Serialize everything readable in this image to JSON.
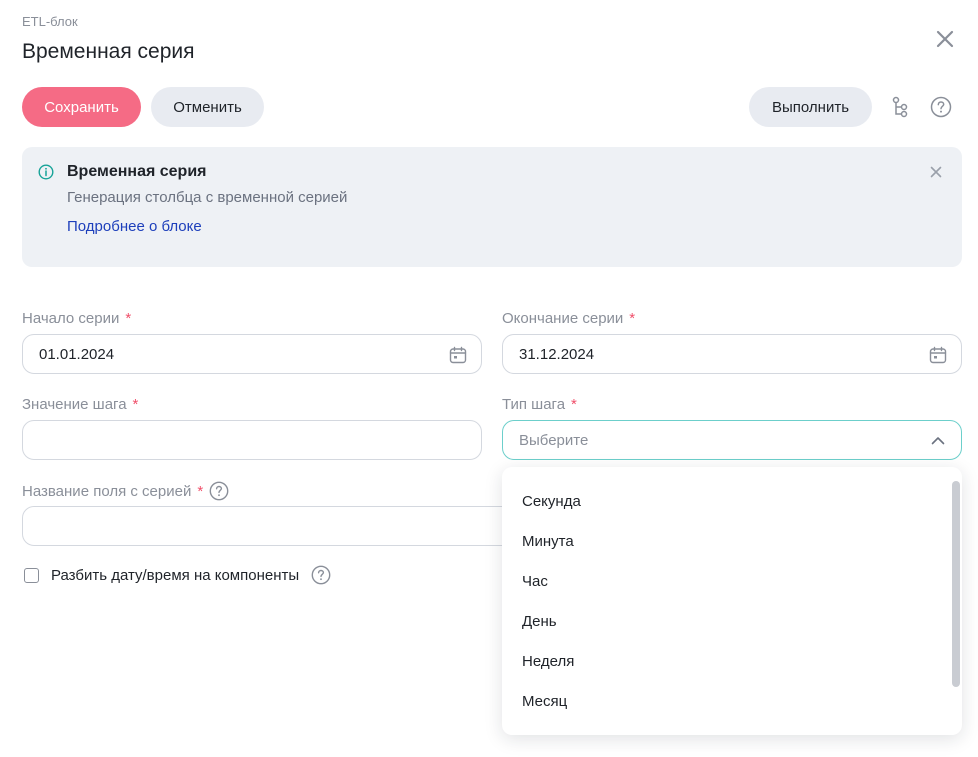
{
  "header": {
    "eyebrow": "ETL-блок",
    "title": "Временная серия"
  },
  "toolbar": {
    "save_label": "Сохранить",
    "cancel_label": "Отменить",
    "run_label": "Выполнить"
  },
  "info": {
    "title": "Временная серия",
    "description": "Генерация столбца с временной серией",
    "link": "Подробнее о блоке"
  },
  "form": {
    "start": {
      "label": "Начало серии",
      "required": "*",
      "value": "01.01.2024"
    },
    "end": {
      "label": "Окончание серии",
      "required": "*",
      "value": "31.12.2024"
    },
    "step_value": {
      "label": "Значение шага",
      "required": "*",
      "value": ""
    },
    "step_type": {
      "label": "Тип шага",
      "required": "*",
      "placeholder": "Выберите"
    },
    "field_name": {
      "label": "Название поля с серией",
      "required": "*",
      "value": ""
    },
    "split_checkbox": {
      "label": "Разбить дату/время на компоненты",
      "checked": false
    }
  },
  "dropdown": {
    "options": [
      "Секунда",
      "Минута",
      "Час",
      "День",
      "Неделя",
      "Месяц"
    ]
  },
  "colors": {
    "primary": "#f56b85",
    "secondary_button": "#e8ebf1",
    "required": "#f04f6a",
    "link": "#1d3fbb",
    "focus_border": "#6ccfcb",
    "info_bg": "#eef1f5",
    "info_icon": "#17a398"
  }
}
